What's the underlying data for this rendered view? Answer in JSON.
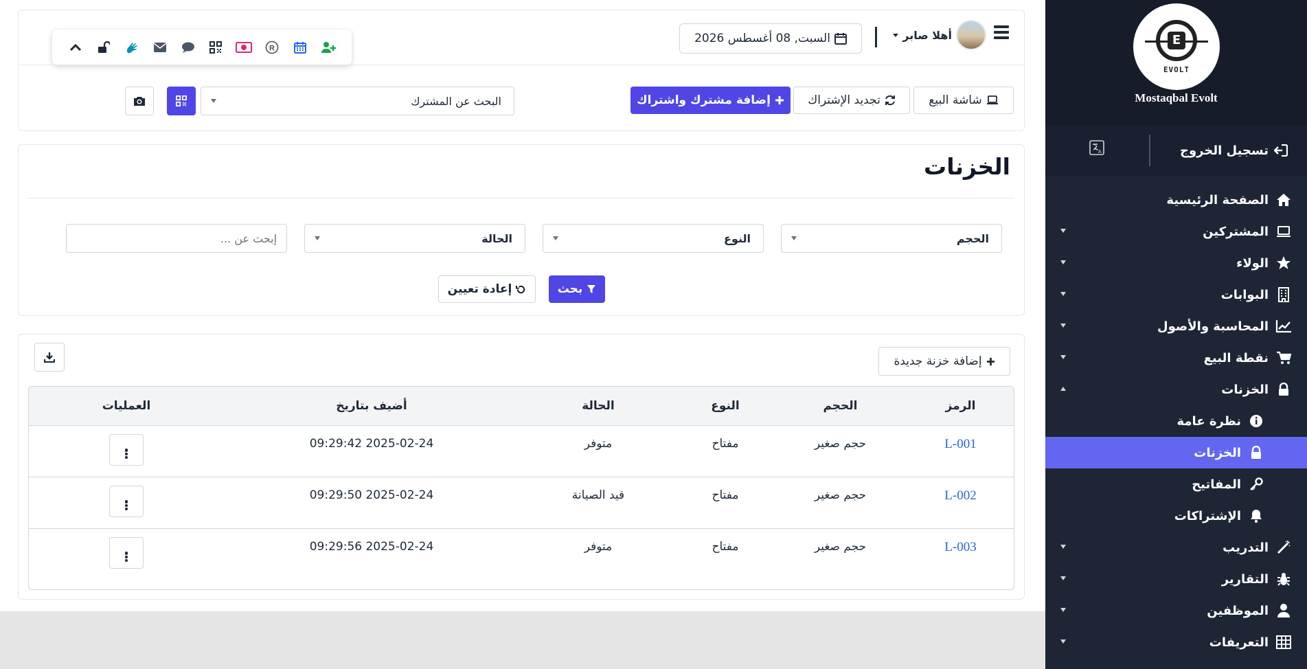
{
  "sidebar": {
    "brand": "Mostaqbal Evolt",
    "logo_text": "EVOLT",
    "logout_label": "تسجيل الخروج",
    "items": [
      {
        "label": "الصفحة الرئيسية",
        "icon": "home-icon"
      },
      {
        "label": "المشتركين",
        "icon": "laptop-icon"
      },
      {
        "label": "الولاء",
        "icon": "star-icon"
      },
      {
        "label": "البوابات",
        "icon": "building-icon"
      },
      {
        "label": "المحاسبة والأصول",
        "icon": "chart-line-icon"
      },
      {
        "label": "نقطة البيع",
        "icon": "cart-icon"
      },
      {
        "label": "الخزنات",
        "icon": "lock-icon"
      },
      {
        "label": "نظرة عامة",
        "icon": "info-icon"
      },
      {
        "label": "الخزنات",
        "icon": "lock-icon"
      },
      {
        "label": "المفاتيح",
        "icon": "key-icon"
      },
      {
        "label": "الإشتراكات",
        "icon": "bell-icon"
      },
      {
        "label": "التدريب",
        "icon": "magic-wand-icon"
      },
      {
        "label": "التقارير",
        "icon": "bug-icon"
      },
      {
        "label": "الموظفين",
        "icon": "user-icon"
      },
      {
        "label": "التعريفات",
        "icon": "table-icon"
      }
    ]
  },
  "header": {
    "user_name": "أهلا صابر",
    "date": "السبت, 08 أغسطس 2026",
    "pos_label": "شاشة البيع",
    "renew_label": "تجديد الإشتراك",
    "add_member_label": "إضافة مشترك واشتراك",
    "member_search_placeholder": "البحث عن المشترك"
  },
  "filters": {
    "page_title": "الخزنات",
    "size_label": "الحجم",
    "type_label": "النوع",
    "status_label": "الحالة",
    "search_placeholder": "إبحث عن ...",
    "search_button": "بحث",
    "reset_button": "إعادة تعيين"
  },
  "table": {
    "add_label": "إضافة خزنة جديدة",
    "columns": [
      "الرمز",
      "الحجم",
      "النوع",
      "الحالة",
      "أضيف بتاريخ",
      "العمليات"
    ],
    "rows": [
      {
        "code": "L-001",
        "size": "حجم صغير",
        "type": "مفتاح",
        "status": "متوفر",
        "added": "2025-02-24 09:29:42"
      },
      {
        "code": "L-002",
        "size": "حجم صغير",
        "type": "مفتاح",
        "status": "قيد الصيانة",
        "added": "2025-02-24 09:29:50"
      },
      {
        "code": "L-003",
        "size": "حجم صغير",
        "type": "مفتاح",
        "status": "متوفر",
        "added": "2025-02-24 09:29:56"
      }
    ]
  },
  "colors": {
    "primary": "#4f46e5",
    "sidebar_bg": "#1e2535",
    "active_item": "#6366f1",
    "link": "#2563eb"
  }
}
